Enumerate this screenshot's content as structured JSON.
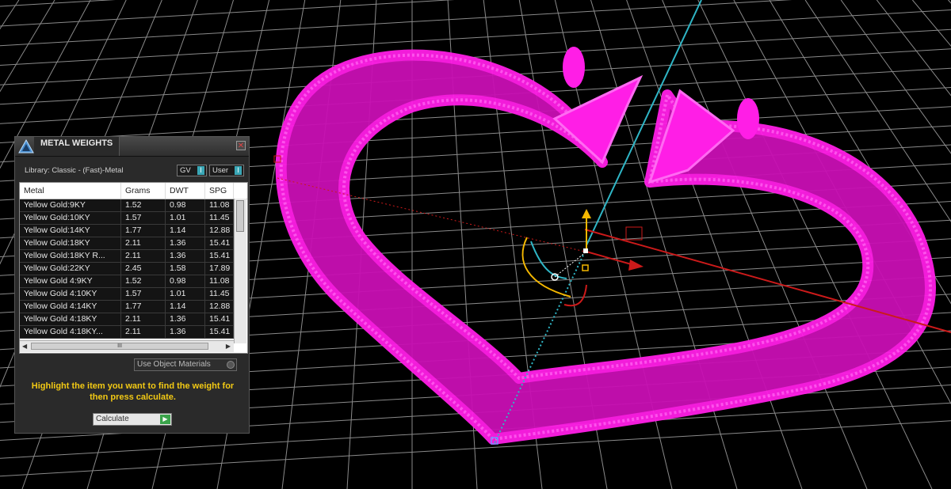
{
  "colors": {
    "viewport_bg": "#000000",
    "grid": "#8a8a8a",
    "model_wire": "#ff1ee6",
    "axis_y": "#2fb6c6",
    "axis_x": "#cc1a1a",
    "gizmo_accent": "#f5b800",
    "instruction_text": "#f2c914"
  },
  "panel": {
    "title": "METAL WEIGHTS",
    "close_icon": "close-icon",
    "library_label": "Library: Classic - (Fast)-Metal",
    "toggles": [
      {
        "label": "GV",
        "indicator": "I"
      },
      {
        "label": "User",
        "indicator": "I"
      }
    ],
    "table": {
      "columns": [
        "Metal",
        "Grams",
        "DWT",
        "SPG"
      ],
      "rows": [
        [
          "Yellow Gold:9KY",
          "1.52",
          "0.98",
          "11.08"
        ],
        [
          "Yellow Gold:10KY",
          "1.57",
          "1.01",
          "11.45"
        ],
        [
          "Yellow Gold:14KY",
          "1.77",
          "1.14",
          "12.88"
        ],
        [
          "Yellow Gold:18KY",
          "2.11",
          "1.36",
          "15.41"
        ],
        [
          "Yellow Gold:18KY R...",
          "2.11",
          "1.36",
          "15.41"
        ],
        [
          "Yellow Gold:22KY",
          "2.45",
          "1.58",
          "17.89"
        ],
        [
          "Yellow Gold 4:9KY",
          "1.52",
          "0.98",
          "11.08"
        ],
        [
          "Yellow Gold 4:10KY",
          "1.57",
          "1.01",
          "11.45"
        ],
        [
          "Yellow Gold 4:14KY",
          "1.77",
          "1.14",
          "12.88"
        ],
        [
          "Yellow Gold 4:18KY",
          "2.11",
          "1.36",
          "15.41"
        ],
        [
          "Yellow Gold 4:18KY...",
          "2.11",
          "1.36",
          "15.41"
        ]
      ]
    },
    "scroll": {
      "left": "◀",
      "right": "▶",
      "thumb": "III"
    },
    "use_object_materials": "Use Object Materials",
    "instructions": "Highlight the item you want to find the weight for then press calculate.",
    "calculate_label": "Calculate",
    "calculate_icon": "▶"
  }
}
